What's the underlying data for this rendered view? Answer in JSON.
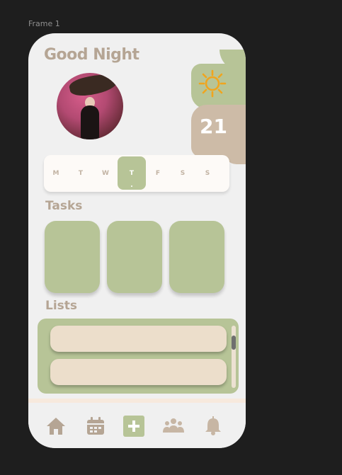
{
  "frame_label": "Frame 1",
  "greeting": "Good Night",
  "weather": {
    "icon": "sun-icon",
    "day_number": "21"
  },
  "week": {
    "days": [
      "M",
      "T",
      "W",
      "T",
      "F",
      "S",
      "S"
    ],
    "selected_index": 3
  },
  "tasks": {
    "title": "Tasks"
  },
  "lists": {
    "title": "Lists"
  },
  "nav": {
    "items": [
      "home-icon",
      "calendar-icon",
      "add-icon",
      "people-icon",
      "bell-icon"
    ]
  },
  "colors": {
    "accent_green": "#b7c497",
    "accent_tan": "#cdbba7",
    "text_tan": "#b5a594",
    "sun": "#f0a51e",
    "list_item": "#ecdecb"
  }
}
